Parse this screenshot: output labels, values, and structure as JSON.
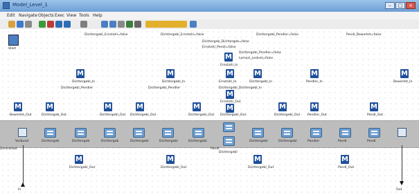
{
  "window": {
    "title": "Model_Level_1",
    "min_icon": "minimize-icon",
    "max_icon": "maximize-icon",
    "close_icon": "close-icon",
    "min_glyph": "–",
    "max_glyph": "□",
    "close_glyph": "×"
  },
  "menu": [
    "Edit",
    "Navigate",
    "Objects",
    "Exec",
    "View",
    "Tools",
    "Help"
  ],
  "labels": {
    "start": "Start",
    "top_vars": [
      "Dichtergebl_Ernstahl=false",
      "Dichtergebl_Ernstahl=false",
      "Dichtergebl_Pendler=false",
      "Pendl_Bewertet=false"
    ],
    "center_vars": [
      "Dichtergeb_Dichtergeb=false",
      "Ernstahl_Pendl=false",
      "Dichtergebl_Pendler=false",
      "Lemosl_Lednet=false"
    ],
    "upper_row": [
      "Dichtergebl_In",
      "Dichtergebl_In",
      "Ernstahl_In",
      "Dichtergebl_In",
      "Pendler_In",
      "Bewertet_In"
    ],
    "upper_row_sub": [
      "Dichtergebl_Pendler",
      "Dichtergebl_Pendler",
      "Dichtergebl_Dichtergebl_In"
    ],
    "center_top_in": "Ernstahl_In",
    "center_out": "Ernstahl_Out",
    "middle_row": [
      "Bewertet_Out",
      "Dichtergeb_Out",
      "Dichtergebl_Out",
      "Dichtergebl_Out",
      "Dichtergebl_Out",
      "Dichtergebl_Out",
      "Dichtergebl_Out",
      "Pendler_Out",
      "Pendl_Out"
    ],
    "band_blocks": [
      "Verbund",
      "Dichtergeb",
      "Dichtergeb",
      "Dichtergeb",
      "Dichtergebl",
      "Dichtergebl",
      "Dichtergebl",
      "Dichtergebl",
      "Dichtergebl",
      "Dichtergebl",
      "Pendler",
      "Pendl",
      "Pendl",
      "Bewertet"
    ],
    "center_band": "Dichtergebl",
    "center_band2": "Pendl",
    "left_band_label": "Zentrallast",
    "lower_row": [
      "Dichtergebl_Out",
      "Dichtergebl_Out",
      "Dichtergebl_Out",
      "Pendl_Out"
    ],
    "bottom_left": "In",
    "bottom_right": "Out"
  }
}
